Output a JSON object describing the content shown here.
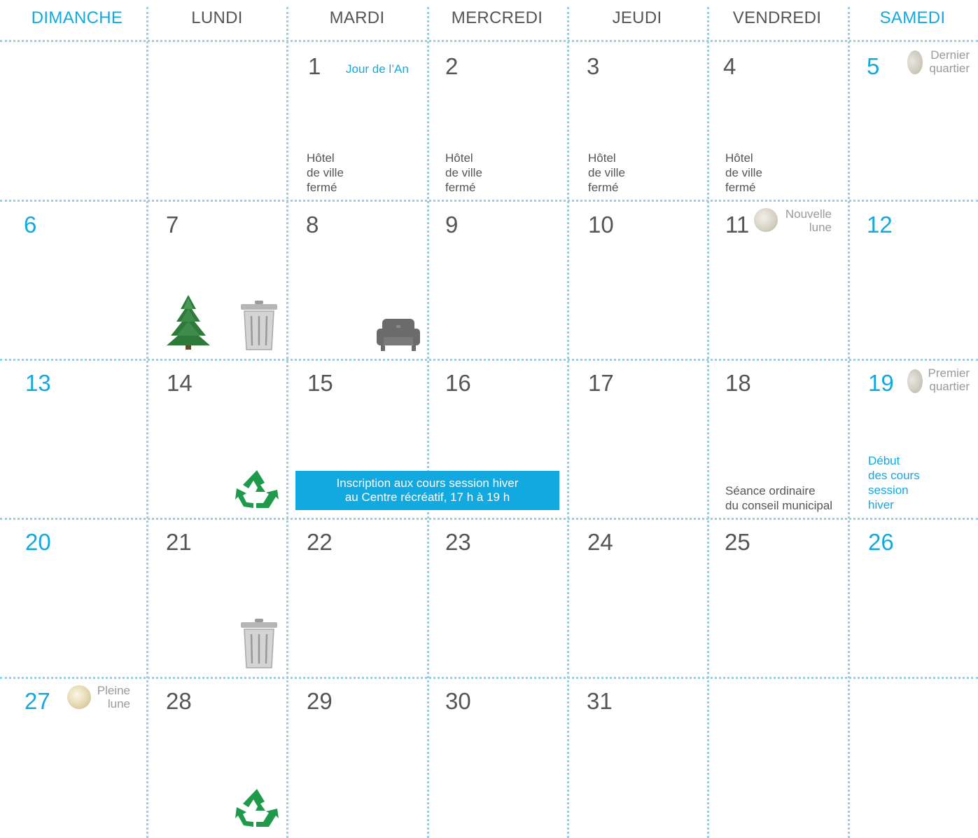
{
  "weekdays": [
    "DIMANCHE",
    "LUNDI",
    "MARDI",
    "MERCREDI",
    "JEUDI",
    "VENDREDI",
    "SAMEDI"
  ],
  "days": [
    "1",
    "2",
    "3",
    "4",
    "5",
    "6",
    "7",
    "8",
    "9",
    "10",
    "11",
    "12",
    "13",
    "14",
    "15",
    "16",
    "17",
    "18",
    "19",
    "20",
    "21",
    "22",
    "23",
    "24",
    "25",
    "26",
    "27",
    "28",
    "29",
    "30",
    "31"
  ],
  "holiday": "Jour de l’An",
  "closed": [
    "Hôtel",
    "de ville",
    "fermé"
  ],
  "moon_phases": {
    "last_quarter": [
      "Dernier",
      "quartier"
    ],
    "new_moon": [
      "Nouvelle",
      "lune"
    ],
    "first_quarter": [
      "Premier",
      "quartier"
    ],
    "full_moon": [
      "Pleine",
      "lune"
    ]
  },
  "registration_banner": [
    "Inscription aux cours session hiver",
    "au Centre récréatif, 17 h à 19 h"
  ],
  "council_meeting": [
    "Séance ordinaire",
    "du conseil municipal"
  ],
  "courses_start": [
    "Début",
    "des cours",
    "session",
    "hiver"
  ],
  "icons": {
    "tree": "christmas-tree-icon",
    "trash": "trash-can-icon",
    "bulky": "armchair-icon",
    "recycle": "recycling-icon"
  },
  "colors": {
    "accent": "#12a9e1",
    "text": "#555555",
    "grid": "#8fd3ef",
    "recycle": "#1f9a4a"
  }
}
